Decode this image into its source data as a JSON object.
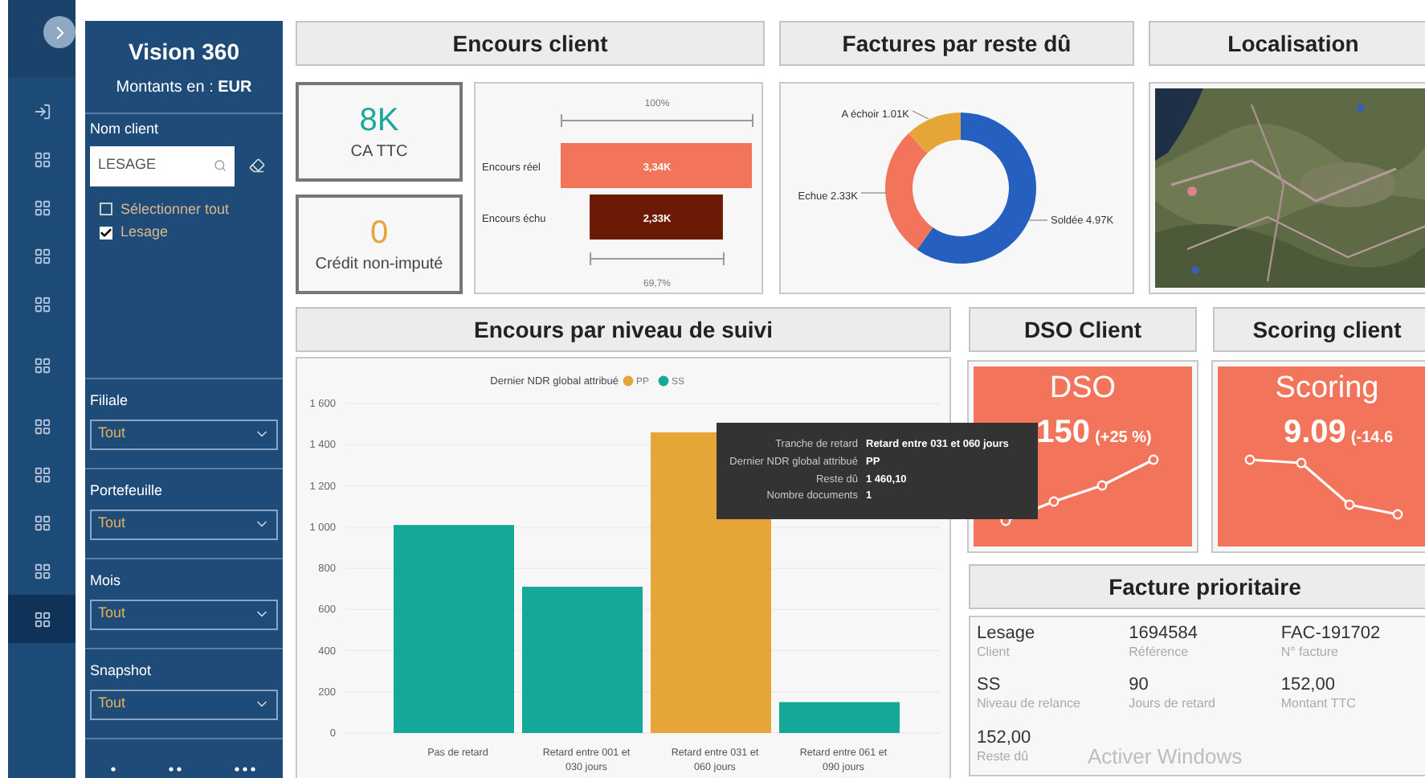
{
  "rail": {
    "items": [
      {
        "kind": "entry",
        "selected": false
      },
      {
        "kind": "page",
        "selected": false
      },
      {
        "kind": "page",
        "selected": false
      },
      {
        "kind": "page",
        "selected": false
      },
      {
        "kind": "page",
        "selected": false
      },
      {
        "kind": "page",
        "selected": false
      },
      {
        "kind": "page",
        "selected": false
      },
      {
        "kind": "page",
        "selected": false
      },
      {
        "kind": "page",
        "selected": false
      },
      {
        "kind": "page",
        "selected": false
      },
      {
        "kind": "page",
        "selected": true
      }
    ]
  },
  "sidebar": {
    "title": "Vision 360",
    "currency": "Montants en : **EUR**",
    "client_filter": {
      "label": "Nom client",
      "search_value": "LESAGE",
      "options": [
        {
          "label": "Sélectionner tout",
          "checked": false
        },
        {
          "label": "Lesage",
          "checked": true
        }
      ]
    },
    "filters": [
      {
        "label": "Filiale",
        "value": "Tout"
      },
      {
        "label": "Portefeuille",
        "value": "Tout"
      },
      {
        "label": "Mois",
        "value": "Tout"
      },
      {
        "label": "Snapshot",
        "value": "Tout"
      }
    ]
  },
  "encours_client": {
    "title": "Encours client",
    "kpis": [
      {
        "value": "8K",
        "label": "CA TTC",
        "color": "#1aa89a"
      },
      {
        "value": "0",
        "label": "Crédit non-imputé",
        "color": "#e8a33a"
      }
    ],
    "funnel": {
      "stages": [
        {
          "label": "Encours réel",
          "value": "3,34K",
          "share": "100%"
        },
        {
          "label": "Encours échu",
          "value": "2,33K",
          "share": "69,7%"
        }
      ]
    }
  },
  "factures": {
    "title": "Factures par reste dû",
    "chart_data": {
      "type": "donut",
      "categories": [
        "Soldée",
        "Echue",
        "A échoir"
      ],
      "values": [
        4970,
        2330,
        1010
      ],
      "value_labels": [
        "4.97K",
        "2.33K",
        "1.01K"
      ]
    }
  },
  "localisation": {
    "title": "Localisation"
  },
  "encours_niveau": {
    "title": "Encours par niveau de suivi",
    "legend_title": "Dernier NDR global attribué",
    "chart_data": {
      "type": "bar",
      "stacked": true,
      "grid": true,
      "legend": "top",
      "categories": [
        "Pas de retard",
        "Retard entre 001 et 030 jours",
        "Retard entre 031 et 060 jours",
        "Retard entre 061 et 090 jours"
      ],
      "series": [
        {
          "name": "PP",
          "color": "#e6a637",
          "values": [
            null,
            null,
            1460,
            null
          ]
        },
        {
          "name": "SS",
          "color": "#14a898",
          "values": [
            1010,
            710,
            null,
            150
          ]
        }
      ],
      "ylim": [
        0,
        1600
      ],
      "yticks": [
        {
          "value": 0,
          "label": "0"
        },
        {
          "value": 200,
          "label": "200"
        },
        {
          "value": 400,
          "label": "400"
        },
        {
          "value": 600,
          "label": "600"
        },
        {
          "value": 800,
          "label": "800"
        },
        {
          "value": 1000,
          "label": "1 000"
        },
        {
          "value": 1200,
          "label": "1 200"
        },
        {
          "value": 1400,
          "label": "1 400"
        },
        {
          "value": 1600,
          "label": "1 600"
        }
      ]
    },
    "tooltip": {
      "rows": [
        {
          "label": "Tranche de retard",
          "value": "Retard entre 031 et 060 jours"
        },
        {
          "label": "Dernier NDR global attribué",
          "value": "PP"
        },
        {
          "label": "Reste dû",
          "value": "1 460,10"
        },
        {
          "label": "Nombre documents",
          "value": "1"
        }
      ]
    }
  },
  "dso": {
    "title": "DSO Client",
    "label": "DSO",
    "value": "150",
    "change": "(+25 %)"
  },
  "scoring": {
    "title": "Scoring client",
    "label": "Scoring",
    "value": "9.09",
    "change": "(-14.6"
  },
  "facture_prioritaire": {
    "title": "Facture prioritaire",
    "fields": [
      {
        "value": "Lesage",
        "label": "Client"
      },
      {
        "value": "1694584",
        "label": "Référence"
      },
      {
        "value": "FAC-191702",
        "label": "N° facture"
      },
      {
        "value": "SS",
        "label": "Niveau de relance"
      },
      {
        "value": "90",
        "label": "Jours de retard"
      },
      {
        "value": "152,00",
        "label": "Montant TTC"
      },
      {
        "value": "152,00",
        "label": "Reste dû"
      }
    ],
    "os_notice": "Activer Windows"
  }
}
